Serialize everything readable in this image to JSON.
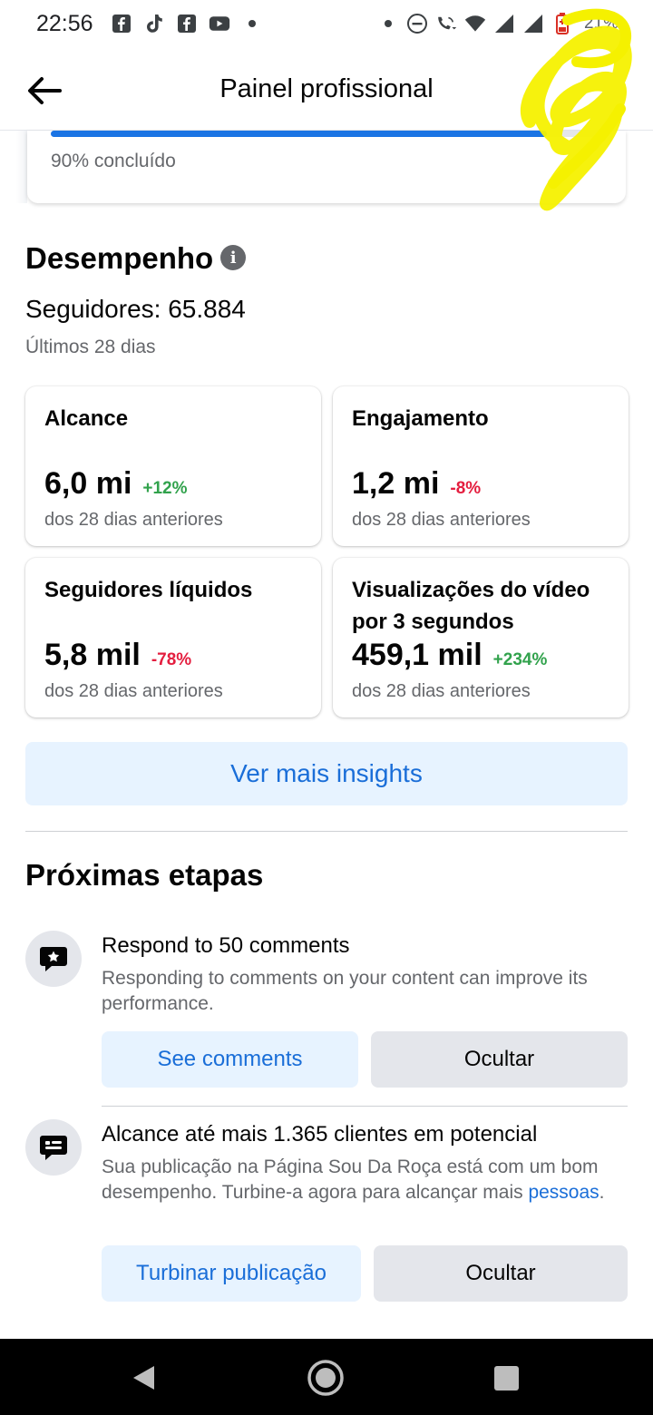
{
  "status_bar": {
    "time": "22:56",
    "left_icons": [
      "facebook-icon",
      "tiktok-icon",
      "facebook-icon",
      "youtube-icon",
      "dot-icon"
    ],
    "right_icons": [
      "dot-icon",
      "do-not-disturb-icon",
      "wifi-call-icon",
      "wifi-icon",
      "signal-icon",
      "signal-icon",
      "battery-low-icon"
    ],
    "battery": "21%"
  },
  "header": {
    "title": "Painel profissional",
    "back_icon": "arrow-left-icon"
  },
  "setup_progress": {
    "progress": 0.9,
    "label": "90% concluído",
    "accent": "#1b74e4"
  },
  "performance": {
    "title": "Desempenho",
    "followers": "Seguidores: 65.884",
    "period": "Últimos 28 dias",
    "metrics": [
      {
        "label": "Alcance",
        "value": "6,0 mi",
        "change": "+12%",
        "trend": "up",
        "sub": "dos 28 dias anteriores"
      },
      {
        "label": "Engajamento",
        "value": "1,2 mi",
        "change": "-8%",
        "trend": "down",
        "sub": "dos 28 dias anteriores"
      },
      {
        "label": "Seguidores líquidos",
        "value": "5,8 mil",
        "change": "-78%",
        "trend": "down",
        "sub": "dos 28 dias anteriores"
      },
      {
        "label": "Visualizações do vídeo por 3 segundos",
        "value": "459,1 mil",
        "change": "+234%",
        "trend": "up",
        "sub": "dos 28 dias anteriores"
      }
    ],
    "insights_button": "Ver mais insights"
  },
  "next_steps": {
    "title": "Próximas etapas",
    "items": [
      {
        "icon": "comment-star-icon",
        "title": "Respond to 50 comments",
        "description": "Responding to comments on your content can improve its performance.",
        "primary_button": "See comments",
        "secondary_button": "Ocultar"
      },
      {
        "icon": "message-lines-icon",
        "title": "Alcance até mais 1.365 clientes em potencial",
        "description": "Sua publicação na Página Sou Da Roça está com um bom desempenho. Turbine-a agora para alcançar mais ",
        "description_link": "pessoas",
        "description_end": ".",
        "primary_button": "Turbinar publicação",
        "secondary_button": "Ocultar"
      }
    ]
  },
  "colors": {
    "positive": "#31a24c",
    "negative": "#e41e3f",
    "link": "#1a6ed8",
    "soft_button": "#e7f3ff",
    "scribble": "#f5f100"
  },
  "nav_bar": {
    "icons": [
      "nav-back-icon",
      "nav-home-icon",
      "nav-recents-icon"
    ]
  }
}
